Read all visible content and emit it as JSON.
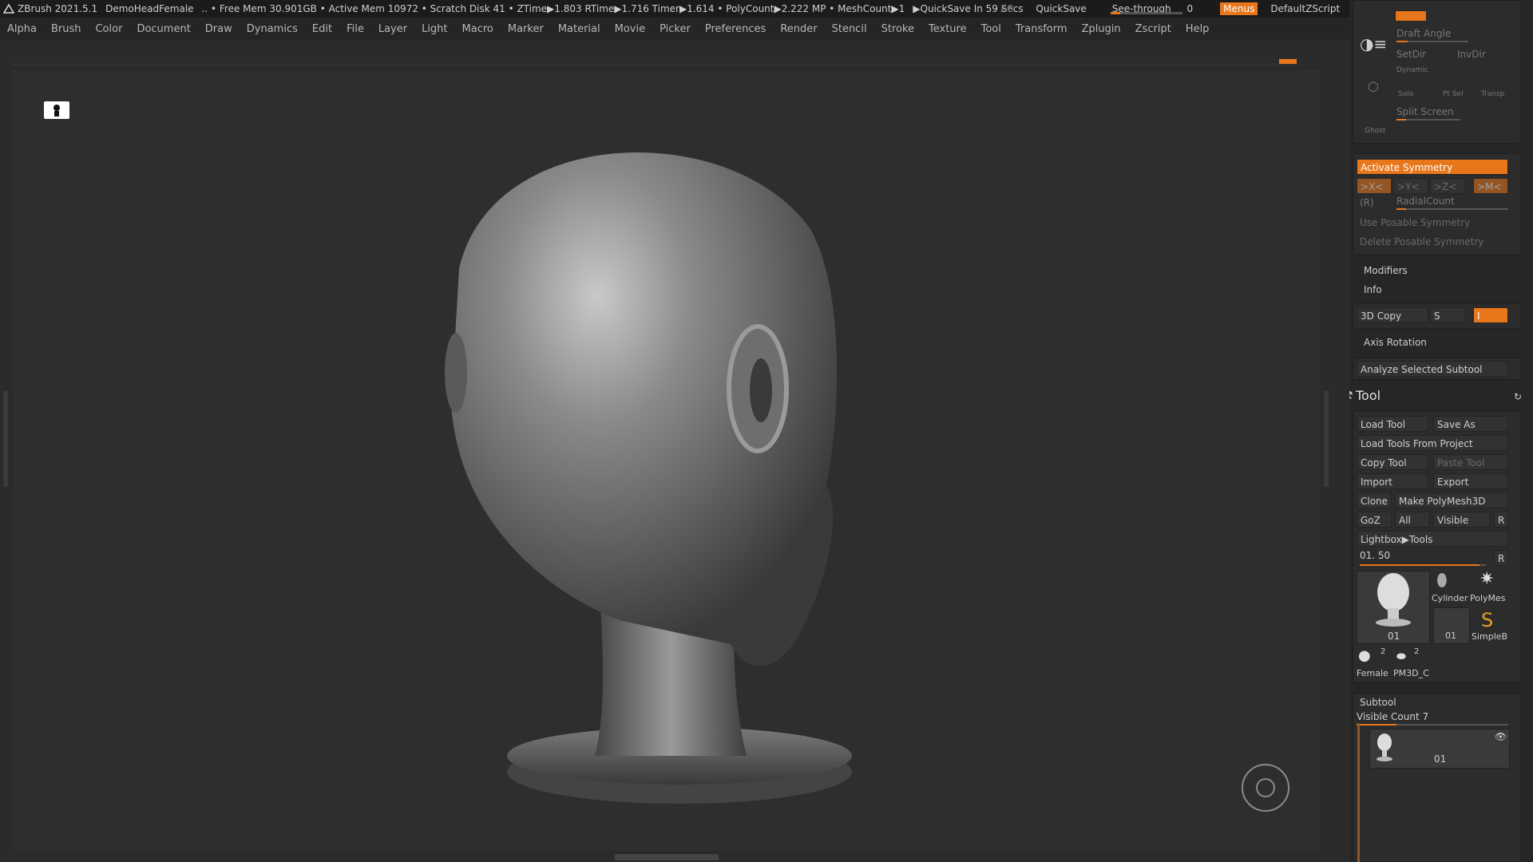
{
  "titlebar": {
    "app_name": "ZBrush 2021.5.1",
    "document_name": "DemoHeadFemale",
    "stats": "..  • Free Mem 30.901GB • Active Mem 10972 • Scratch Disk 41 •  ZTime▶1.803 RTime▶1.716 Timer▶1.614 • PolyCount▶2.222 MP  • MeshCount▶1",
    "quicksave_countdown": "▶QuickSave In 59 Secs",
    "ac_label": "AC",
    "quicksave_button": "QuickSave",
    "see_through_label": "See-through",
    "see_through_value": "0",
    "menus_button": "Menus",
    "default_zscript": "DefaultZScript",
    "accent_color": "#e8771c"
  },
  "menubar": {
    "items": [
      "Alpha",
      "Brush",
      "Color",
      "Document",
      "Draw",
      "Dynamics",
      "Edit",
      "File",
      "Layer",
      "Light",
      "Macro",
      "Marker",
      "Material",
      "Movie",
      "Picker",
      "Preferences",
      "Render",
      "Stencil",
      "Stroke",
      "Texture",
      "Tool",
      "Transform",
      "Zplugin",
      "Zscript",
      "Help"
    ]
  },
  "panel": {
    "transform": {
      "draft_angle": "Draft Angle",
      "setdir": "SetDir",
      "invdir": "InvDir",
      "dynamic": "Dynamic",
      "solo": "Solo",
      "ptsel": "Pt Sel",
      "transp": "Transp",
      "ghost": "Ghost",
      "split_screen": "Split Screen"
    },
    "symmetry": {
      "activate": "Activate Symmetry",
      "x": ">X<",
      "y": ">Y<",
      "z": ">Z<",
      "m": ">M<",
      "r": "(R)",
      "radial_count": "RadialCount",
      "use_posable": "Use Posable Symmetry",
      "delete_posable": "Delete Posable Symmetry"
    },
    "modifiers": "Modifiers",
    "info": "Info",
    "copy3d": "3D Copy",
    "s_label": "S",
    "i_label": "I",
    "axis_rotation": "Axis Rotation",
    "analyze": "Analyze Selected Subtool",
    "tool": {
      "title": "Tool",
      "load_tool": "Load Tool",
      "save_as": "Save As",
      "load_from_project": "Load Tools From Project",
      "copy_tool": "Copy Tool",
      "paste_tool": "Paste Tool",
      "import": "Import",
      "export": "Export",
      "clone": "Clone",
      "make_polymesh": "Make PolyMesh3D",
      "goz": "GoZ",
      "all": "All",
      "visible": "Visible",
      "r": "R",
      "lightbox": "Lightbox▶Tools",
      "value": "01. 50",
      "r2": "R",
      "thumbs": {
        "main": "01",
        "cylinder": "Cylinder",
        "polymesh": "PolyMes",
        "small01": "01",
        "simpleb": "SimpleB",
        "female": "Female",
        "female_count": "2",
        "pm3d": "PM3D_C",
        "pm3d_count": "2"
      }
    },
    "subtool": {
      "title": "Subtool",
      "visible_count": "Visible Count 7",
      "item_name": "01"
    }
  }
}
